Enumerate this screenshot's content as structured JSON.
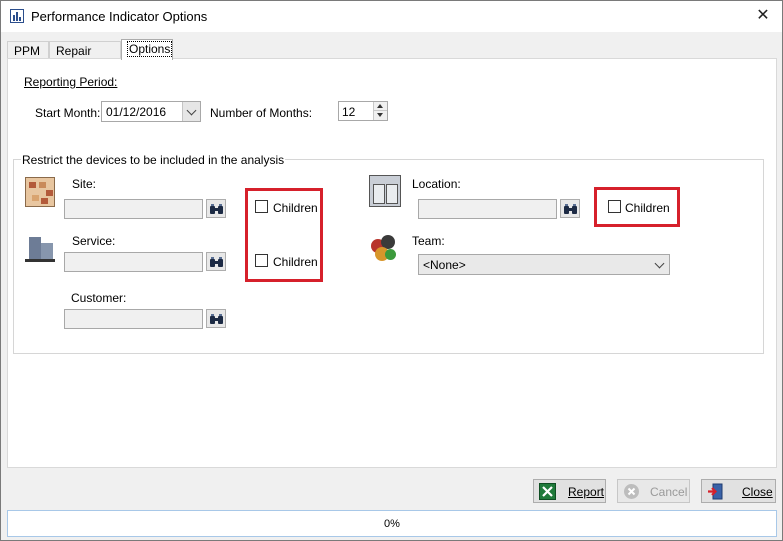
{
  "window": {
    "title": "Performance Indicator Options",
    "close_glyph": "✕"
  },
  "tabs": [
    {
      "label": "PPM",
      "active": false
    },
    {
      "label": "Repair Work",
      "active": false
    },
    {
      "label": "Options",
      "active": true
    }
  ],
  "reporting_period": {
    "heading": "Reporting Period:",
    "start_month_label": "Start Month:",
    "start_month_value": "01/12/2016",
    "num_months_label": "Number of Months:",
    "num_months_value": "12"
  },
  "restrict": {
    "title": "Restrict the devices to be included in the analysis",
    "site_label": "Site:",
    "site_value": "",
    "service_label": "Service:",
    "service_value": "",
    "customer_label": "Customer:",
    "customer_value": "",
    "location_label": "Location:",
    "location_value": "",
    "team_label": "Team:",
    "team_value": "<None>",
    "children_site_label": "Children",
    "children_service_label": "Children",
    "children_location_label": "Children",
    "icons": {
      "site": "site-map-icon",
      "service": "building-icon",
      "location": "doors-icon",
      "team": "team-people-icon",
      "find": "binoculars-icon"
    }
  },
  "buttons": {
    "report_label": "Report",
    "cancel_label": "Cancel",
    "close_label": "Close"
  },
  "status": {
    "progress_text": "0%",
    "progress": 0
  },
  "colors": {
    "highlight": "#d6202b",
    "progress_border": "#a8c8e8"
  }
}
